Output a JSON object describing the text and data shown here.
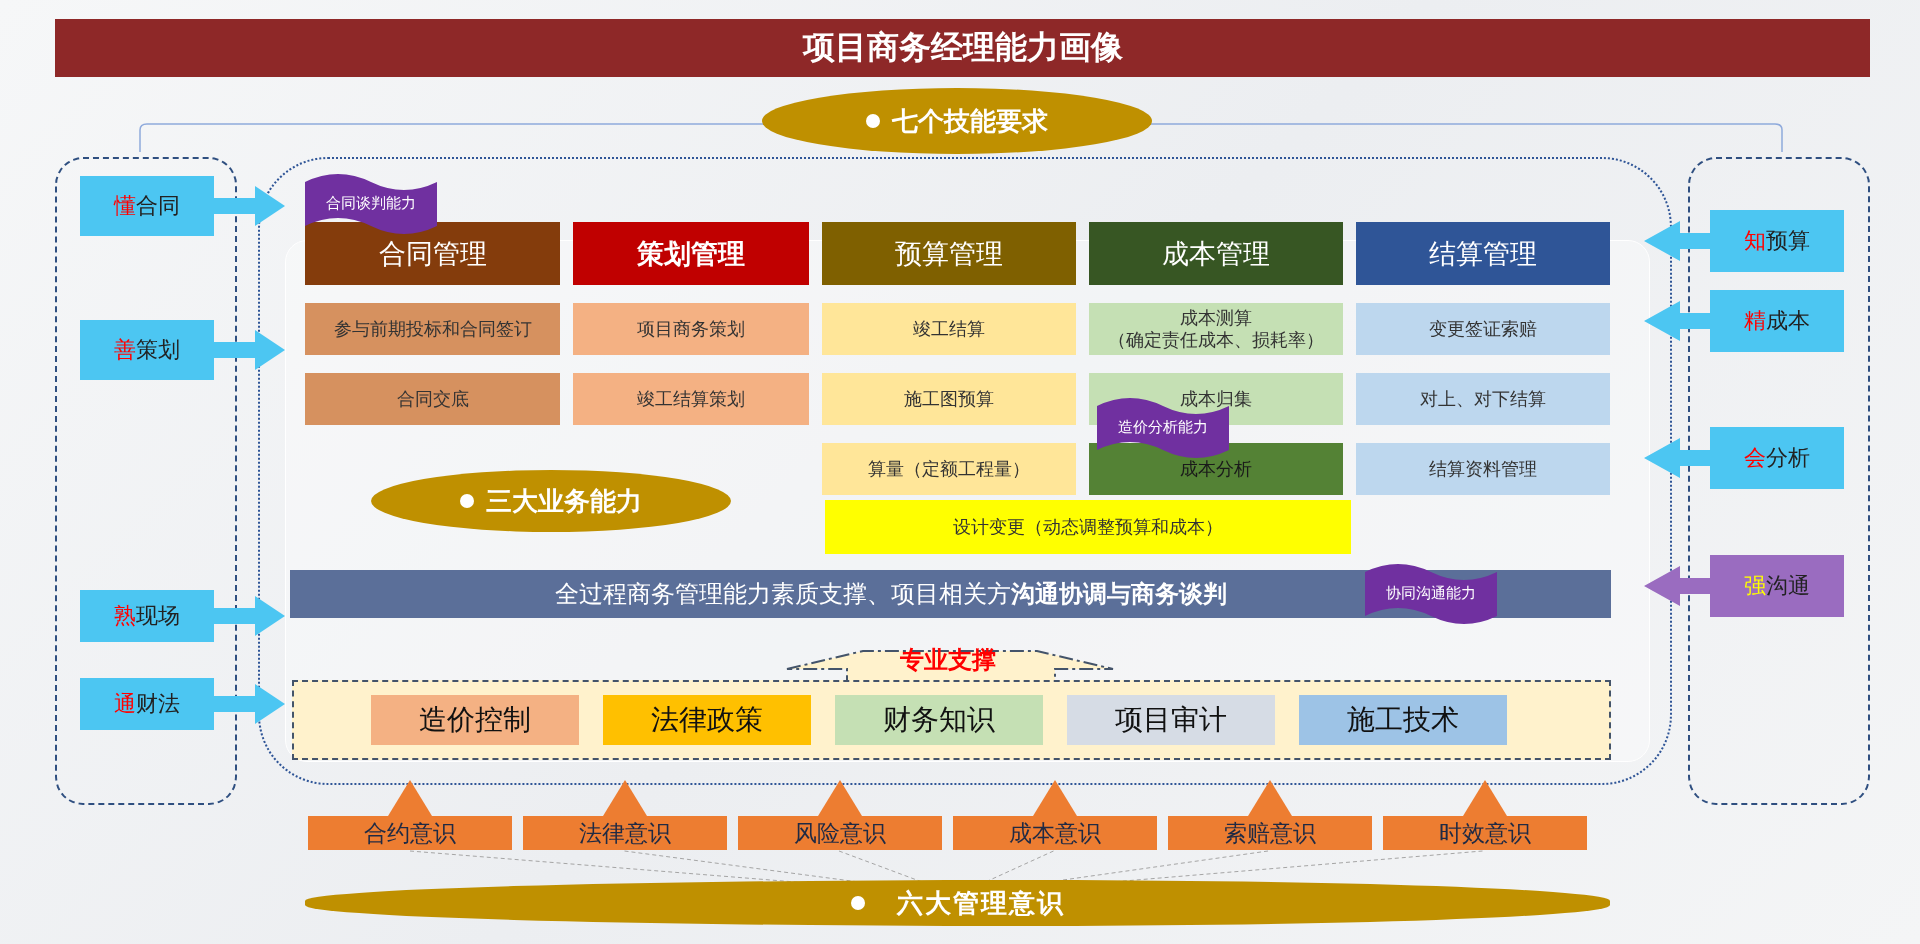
{
  "title": "项目商务经理能力画像",
  "skills_oval": {
    "label": "七个技能要求"
  },
  "left_skills": [
    {
      "highlight": "懂",
      "text": "合同"
    },
    {
      "highlight": "善",
      "text": "策划"
    },
    {
      "highlight": "熟",
      "text": "现场"
    },
    {
      "highlight": "通",
      "text": "财法"
    }
  ],
  "right_skills": [
    {
      "kind": "skill",
      "highlight": "知",
      "text": "预算"
    },
    {
      "kind": "skill",
      "highlight": "精",
      "text": "成本"
    },
    {
      "kind": "skill",
      "highlight": "会",
      "text": "分析"
    },
    {
      "kind": "communication",
      "highlight": "强",
      "text": "沟通"
    }
  ],
  "columns": [
    {
      "header": "合同管理",
      "color": "#843c0c",
      "emphasized": false,
      "items": [
        {
          "text": "参与前期投标和合同签订",
          "emphasized": false
        },
        {
          "text": "合同交底",
          "emphasized": false
        }
      ]
    },
    {
      "header": "策划管理",
      "color": "#c00000",
      "emphasized": true,
      "items": [
        {
          "text": "项目商务策划",
          "emphasized": false
        },
        {
          "text": "竣工结算策划",
          "emphasized": false
        }
      ]
    },
    {
      "header": "预算管理",
      "color": "#7f6000",
      "emphasized": false,
      "items": [
        {
          "text": "竣工结算",
          "emphasized": false
        },
        {
          "text": "施工图预算",
          "emphasized": false
        },
        {
          "text": "算量（定额工程量）",
          "emphasized": false
        }
      ]
    },
    {
      "header": "成本管理",
      "color": "#375623",
      "emphasized": false,
      "items": [
        {
          "text": "成本测算",
          "subtext": "（确定责任成本、损耗率）",
          "emphasized": false
        },
        {
          "text": "成本归集",
          "emphasized": false
        },
        {
          "text": "成本分析",
          "emphasized": true
        }
      ]
    },
    {
      "header": "结算管理",
      "color": "#2f5597",
      "emphasized": false,
      "items": [
        {
          "text": "变更签证索赔",
          "emphasized": false
        },
        {
          "text": "对上、对下结算",
          "emphasized": false
        },
        {
          "text": "结算资料管理",
          "emphasized": false
        }
      ]
    }
  ],
  "design_change": "设计变更（动态调整预算和成本）",
  "flags": [
    {
      "label": "合同谈判能力"
    },
    {
      "label": "造价分析能力"
    },
    {
      "label": "协同沟通能力"
    }
  ],
  "business_oval": {
    "label": "三大业务能力"
  },
  "support_bar": "全过程商务管理能力素质支撑、项目相关方**沟通协调与商务谈判**",
  "professional": {
    "title": "专业支撑",
    "items": [
      "造价控制",
      "法律政策",
      "财务知识",
      "项目审计",
      "施工技术"
    ]
  },
  "awareness": [
    "合约意识",
    "法律意识",
    "风险意识",
    "成本意识",
    "索赔意识",
    "时效意识"
  ],
  "awareness_oval": {
    "label": "六大管理意识"
  }
}
